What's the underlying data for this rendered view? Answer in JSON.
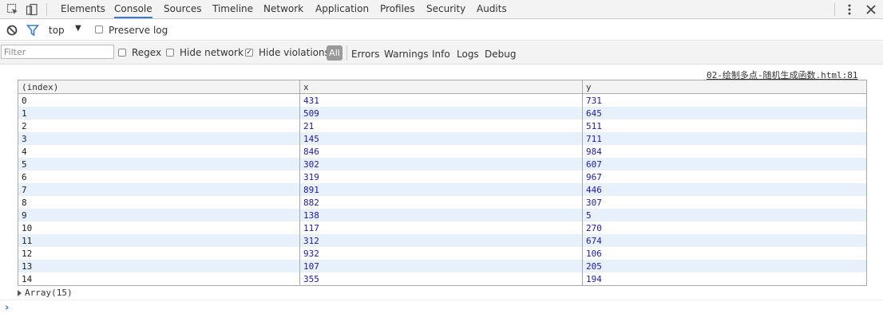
{
  "tabs": [
    "Elements",
    "Console",
    "Sources",
    "Timeline",
    "Network",
    "Application",
    "Profiles",
    "Security",
    "Audits"
  ],
  "selected_tab": "Console",
  "context": {
    "value": "top"
  },
  "preserve_log": {
    "label": "Preserve log",
    "checked": false
  },
  "filter": {
    "placeholder": "Filter",
    "value": ""
  },
  "regex": {
    "label": "Regex",
    "checked": false
  },
  "hide_network": {
    "label": "Hide network",
    "checked": false
  },
  "hide_violations": {
    "label": "Hide violations",
    "checked": true
  },
  "levels": [
    "All",
    "Errors",
    "Warnings",
    "Info",
    "Logs",
    "Debug"
  ],
  "log_source": "02-绘制多点-随机生成函数.html:81",
  "table": {
    "headers": [
      "(index)",
      "x",
      "y"
    ],
    "rows": [
      [
        "0",
        "431",
        "731"
      ],
      [
        "1",
        "509",
        "645"
      ],
      [
        "2",
        "21",
        "511"
      ],
      [
        "3",
        "145",
        "711"
      ],
      [
        "4",
        "846",
        "984"
      ],
      [
        "5",
        "302",
        "607"
      ],
      [
        "6",
        "319",
        "967"
      ],
      [
        "7",
        "891",
        "446"
      ],
      [
        "8",
        "882",
        "307"
      ],
      [
        "9",
        "138",
        "5"
      ],
      [
        "10",
        "117",
        "270"
      ],
      [
        "11",
        "312",
        "674"
      ],
      [
        "12",
        "932",
        "106"
      ],
      [
        "13",
        "107",
        "205"
      ],
      [
        "14",
        "355",
        "194"
      ]
    ]
  },
  "array_summary": "Array(15)",
  "prompt_symbol": "›",
  "colors": {
    "accent": "#3879d9",
    "number": "#1a1aa6",
    "row_stripe": "#e8f0fc",
    "toolbar_bg": "#f3f3f3"
  }
}
